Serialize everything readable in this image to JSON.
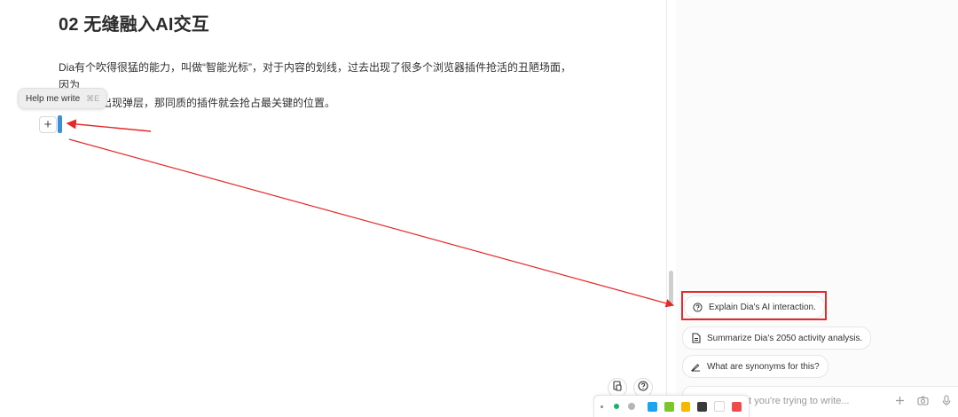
{
  "document": {
    "title": "02 无缝融入AI交互",
    "paragraph_line1": "Dia有个吹得很猛的能力，叫做“智能光标”，对于内容的划线，过去出现了很多个浏览器插件抢活的丑陋场面，因为",
    "paragraph_line2": "划线后会出现弹层，那同质的插件就会抢占最关键的位置。"
  },
  "tooltip": {
    "label": "Help me write",
    "shortcut": "⌘E"
  },
  "editor_controls": {
    "add_symbol": "+"
  },
  "suggestions": [
    {
      "label": "Explain Dia's AI interaction.",
      "icon": "question-circle-icon"
    },
    {
      "label": "Summarize Dia's 2050 activity analysis.",
      "icon": "document-icon"
    },
    {
      "label": "What are synonyms for this?",
      "icon": "pencil-icon"
    }
  ],
  "chat_input": {
    "placeholder_visible": "at you're trying to write...",
    "icons": [
      "plus-icon",
      "camera-icon",
      "microphone-icon"
    ]
  },
  "colors": {
    "accent_blue": "#3b8fd9",
    "annotation_red": "#e52828",
    "palette": [
      "#1aa3ee",
      "#7cc52a",
      "#f5b800",
      "#3a3a3a",
      "#ffffff",
      "#f04b4b"
    ],
    "dots": [
      "#888888",
      "#18b26b",
      "#b5b5b5"
    ]
  }
}
